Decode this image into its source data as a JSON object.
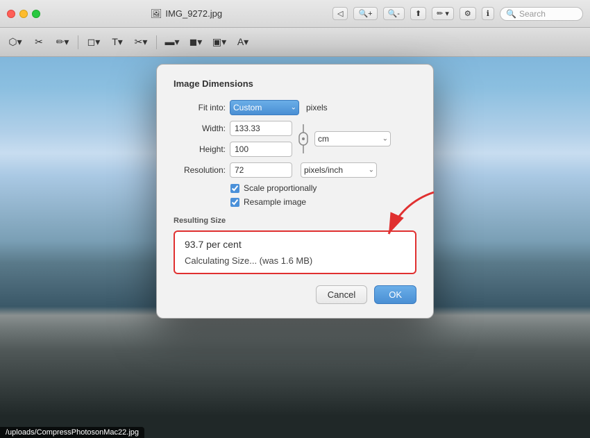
{
  "window": {
    "title": "IMG_9272.jpg",
    "title_icon": "🖼"
  },
  "titlebar": {
    "search_placeholder": "Search"
  },
  "dialog": {
    "title": "Image Dimensions",
    "fit_into_label": "Fit into:",
    "fit_option": "Custom",
    "fit_unit": "pixels",
    "width_label": "Width:",
    "width_value": "133.33",
    "height_label": "Height:",
    "height_value": "100",
    "unit_option": "cm",
    "resolution_label": "Resolution:",
    "resolution_value": "72",
    "resolution_unit": "pixels/inch",
    "scale_label": "Scale proportionally",
    "resample_label": "Resample image",
    "resulting_size_label": "Resulting Size",
    "percentage": "93.7 per cent",
    "calculating": "Calculating Size... (was 1.6 MB)",
    "cancel_label": "Cancel",
    "ok_label": "OK"
  },
  "bottom_bar": {
    "url": "/uploads/CompressPhotosonMac22.jpg"
  },
  "toolbar2": {
    "tools": [
      "⬡",
      "⌖",
      "✏",
      "◻",
      "T",
      "✂",
      "⬛",
      "▣",
      "◉",
      "A"
    ]
  }
}
